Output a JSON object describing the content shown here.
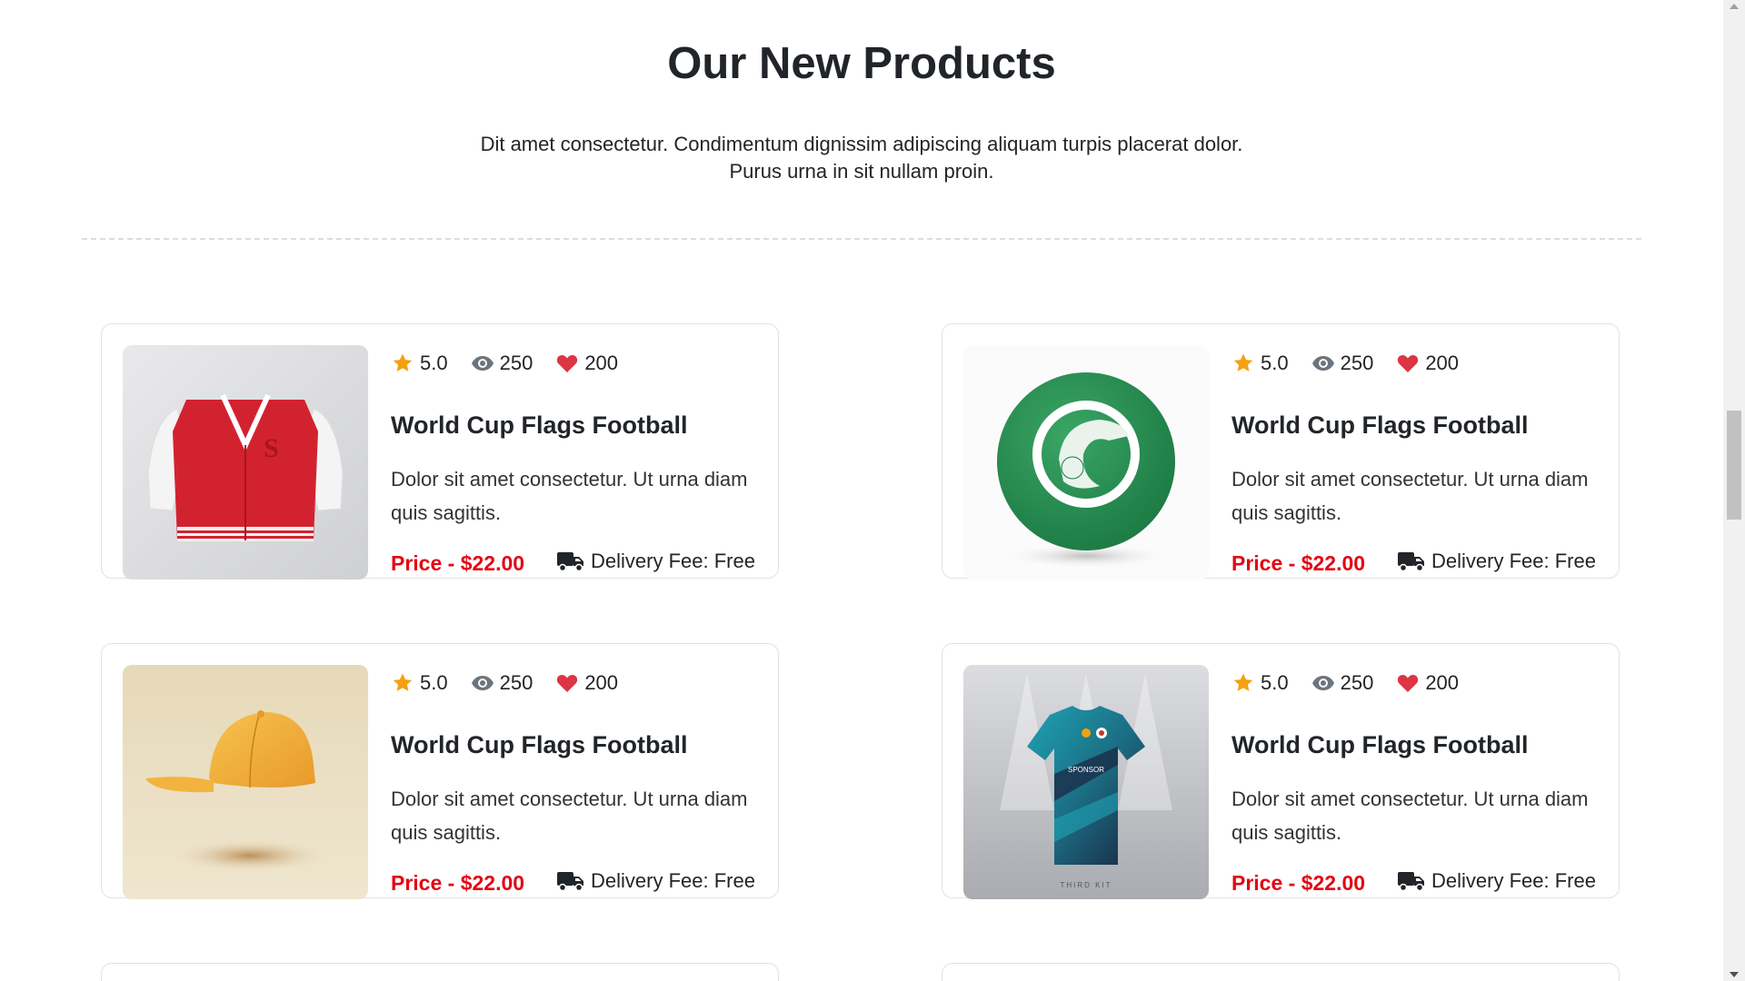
{
  "section": {
    "title": "Our New Products",
    "subtitle": "Dit amet consectetur. Condimentum dignissim adipiscing aliquam turpis placerat dolor. Purus urna in sit nullam proin."
  },
  "products": [
    {
      "image": "red-varsity-jacket",
      "rating": "5.0",
      "views": "250",
      "likes": "200",
      "title": "World Cup Flags Football",
      "description": "Dolor sit amet consectetur. Ut urna diam quis sagittis.",
      "price": "Price - $22.00",
      "delivery": "Delivery Fee: Free"
    },
    {
      "image": "green-football",
      "rating": "5.0",
      "views": "250",
      "likes": "200",
      "title": "World Cup Flags Football",
      "description": "Dolor sit amet consectetur. Ut urna diam quis sagittis.",
      "price": "Price - $22.00",
      "delivery": "Delivery Fee: Free"
    },
    {
      "image": "orange-cap",
      "rating": "5.0",
      "views": "250",
      "likes": "200",
      "title": "World Cup Flags Football",
      "description": "Dolor sit amet consectetur. Ut urna diam quis sagittis.",
      "price": "Price - $22.00",
      "delivery": "Delivery Fee: Free"
    },
    {
      "image": "teal-football-jersey",
      "rating": "5.0",
      "views": "250",
      "likes": "200",
      "title": "World Cup Flags Football",
      "description": "Dolor sit amet consectetur. Ut urna diam quis sagittis.",
      "price": "Price - $22.00",
      "delivery": "Delivery Fee: Free"
    }
  ],
  "image_text": {
    "jacket_letter": "S",
    "jersey_sponsor": "SPONSOR",
    "jersey_caption": "THIRD KIT"
  },
  "colors": {
    "price": "#e30613",
    "star": "#f5a00f",
    "heart": "#dc3545",
    "eye": "#6c757d",
    "text": "#212529"
  },
  "icons": {
    "rating": "star-icon",
    "views": "eye-icon",
    "likes": "heart-icon",
    "delivery": "truck-icon"
  }
}
